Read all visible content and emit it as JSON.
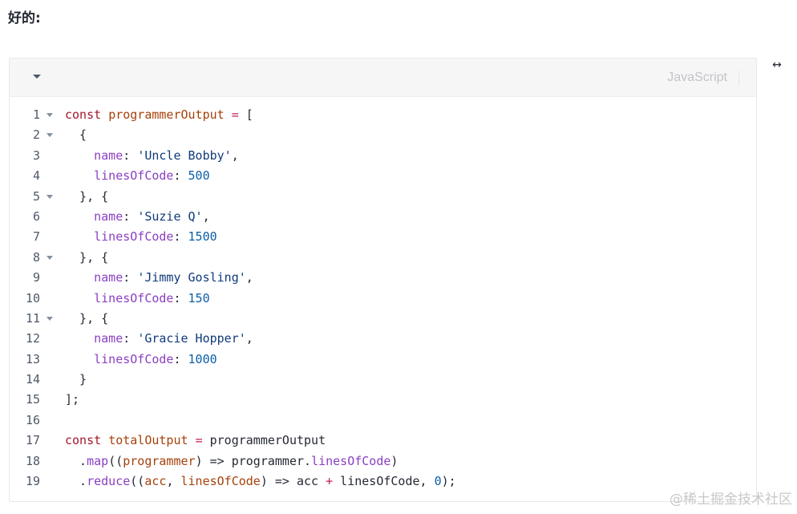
{
  "heading": "好的:",
  "code_block": {
    "language": "JavaScript",
    "collapse_icon": "caret-down-icon",
    "wrap_icon_glyph": "↔",
    "foldable_lines": [
      1,
      2,
      5,
      8,
      11
    ],
    "lines": [
      [
        [
          "kw",
          "const "
        ],
        [
          "def",
          "programmerOutput"
        ],
        [
          "pln",
          " "
        ],
        [
          "op",
          "="
        ],
        [
          "pln",
          " ["
        ]
      ],
      [
        [
          "pln",
          "  {"
        ]
      ],
      [
        [
          "pln",
          "    "
        ],
        [
          "prop",
          "name"
        ],
        [
          "pln",
          ": "
        ],
        [
          "str",
          "'Uncle Bobby'"
        ],
        [
          "pln",
          ","
        ]
      ],
      [
        [
          "pln",
          "    "
        ],
        [
          "prop",
          "linesOfCode"
        ],
        [
          "pln",
          ": "
        ],
        [
          "num",
          "500"
        ]
      ],
      [
        [
          "pln",
          "  }, {"
        ]
      ],
      [
        [
          "pln",
          "    "
        ],
        [
          "prop",
          "name"
        ],
        [
          "pln",
          ": "
        ],
        [
          "str",
          "'Suzie Q'"
        ],
        [
          "pln",
          ","
        ]
      ],
      [
        [
          "pln",
          "    "
        ],
        [
          "prop",
          "linesOfCode"
        ],
        [
          "pln",
          ": "
        ],
        [
          "num",
          "1500"
        ]
      ],
      [
        [
          "pln",
          "  }, {"
        ]
      ],
      [
        [
          "pln",
          "    "
        ],
        [
          "prop",
          "name"
        ],
        [
          "pln",
          ": "
        ],
        [
          "str",
          "'Jimmy Gosling'"
        ],
        [
          "pln",
          ","
        ]
      ],
      [
        [
          "pln",
          "    "
        ],
        [
          "prop",
          "linesOfCode"
        ],
        [
          "pln",
          ": "
        ],
        [
          "num",
          "150"
        ]
      ],
      [
        [
          "pln",
          "  }, {"
        ]
      ],
      [
        [
          "pln",
          "    "
        ],
        [
          "prop",
          "name"
        ],
        [
          "pln",
          ": "
        ],
        [
          "str",
          "'Gracie Hopper'"
        ],
        [
          "pln",
          ","
        ]
      ],
      [
        [
          "pln",
          "    "
        ],
        [
          "prop",
          "linesOfCode"
        ],
        [
          "pln",
          ": "
        ],
        [
          "num",
          "1000"
        ]
      ],
      [
        [
          "pln",
          "  }"
        ]
      ],
      [
        [
          "pln",
          "];"
        ]
      ],
      [],
      [
        [
          "kw",
          "const "
        ],
        [
          "def",
          "totalOutput"
        ],
        [
          "pln",
          " "
        ],
        [
          "op",
          "="
        ],
        [
          "pln",
          " programmerOutput"
        ]
      ],
      [
        [
          "pln",
          "  ."
        ],
        [
          "prop",
          "map"
        ],
        [
          "pln",
          "(("
        ],
        [
          "param",
          "programmer"
        ],
        [
          "pln",
          ") => programmer."
        ],
        [
          "prop",
          "linesOfCode"
        ],
        [
          "pln",
          ")"
        ]
      ],
      [
        [
          "pln",
          "  ."
        ],
        [
          "prop",
          "reduce"
        ],
        [
          "pln",
          "(("
        ],
        [
          "param",
          "acc"
        ],
        [
          "pln",
          ", "
        ],
        [
          "param",
          "linesOfCode"
        ],
        [
          "pln",
          ") => acc "
        ],
        [
          "op",
          "+"
        ],
        [
          "pln",
          " linesOfCode, "
        ],
        [
          "num",
          "0"
        ],
        [
          "pln",
          ");"
        ]
      ]
    ]
  },
  "watermark": "@稀土掘金技术社区"
}
